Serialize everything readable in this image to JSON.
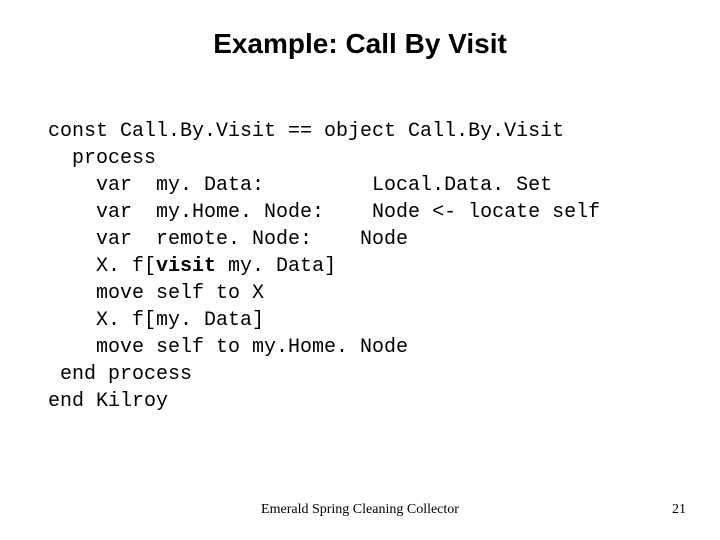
{
  "title": "Example: Call By Visit",
  "code": {
    "l1": "const Call.By.Visit == object Call.By.Visit",
    "l2": "  process",
    "l3a": "    var  my. Data:         Local.Data. Set",
    "l4": "    var  my.Home. Node:    Node <- locate self",
    "l5": "    var  remote. Node:    Node",
    "l6a": "    X. f[",
    "l6b": "visit",
    "l6c": " my. Data]",
    "l7": "    move self to X",
    "l8": "    X. f[my. Data]",
    "l9": "    move self to my.Home. Node",
    "l10": " end process",
    "l11": "end Kilroy"
  },
  "footer": "Emerald Spring Cleaning Collector",
  "page": "21"
}
